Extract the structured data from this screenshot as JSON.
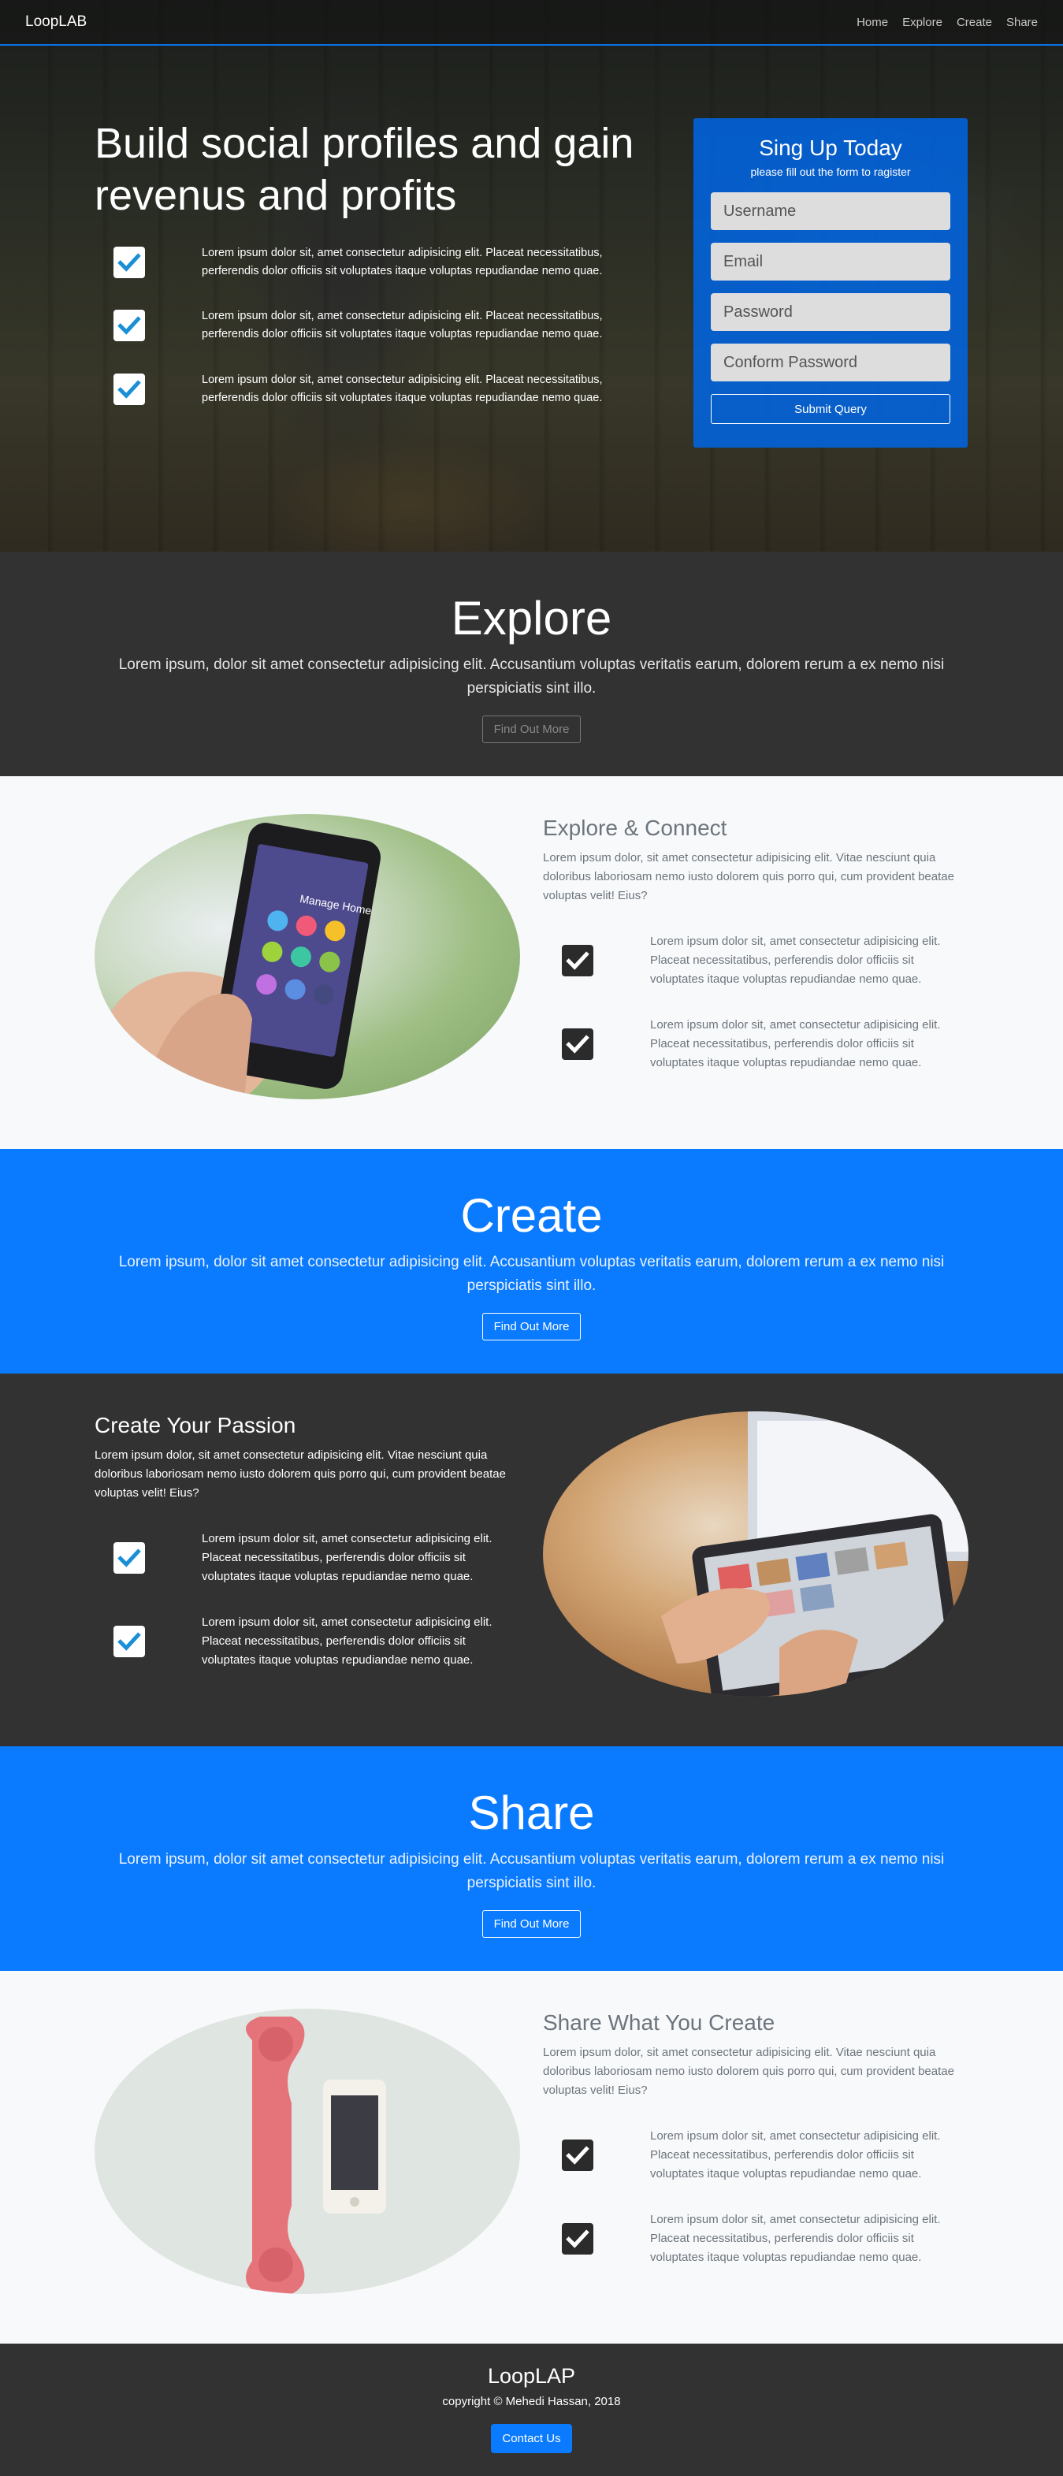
{
  "navbar": {
    "brand": "LoopLAB",
    "links": [
      "Home",
      "Explore",
      "Create",
      "Share"
    ]
  },
  "hero": {
    "title_part1": "Build ",
    "title_bold1": "social profiles",
    "title_part2": " and gain revenus and ",
    "title_bold2": "profits",
    "features": [
      "Lorem ipsum dolor sit, amet consectetur adipisicing elit. Placeat necessitatibus, perferendis dolor officiis sit voluptates itaque voluptas repudiandae nemo quae.",
      "Lorem ipsum dolor sit, amet consectetur adipisicing elit. Placeat necessitatibus, perferendis dolor officiis sit voluptates itaque voluptas repudiandae nemo quae.",
      "Lorem ipsum dolor sit, amet consectetur adipisicing elit. Placeat necessitatibus, perferendis dolor officiis sit voluptates itaque voluptas repudiandae nemo quae."
    ]
  },
  "signup": {
    "title": "Sing Up Today",
    "subtitle": "please fill out the form to ragister",
    "username_placeholder": "Username",
    "email_placeholder": "Email",
    "password_placeholder": "Password",
    "confirm_placeholder": "Conform Password",
    "submit_label": "Submit Query"
  },
  "explore_cta": {
    "heading": "Explore",
    "text": "Lorem ipsum, dolor sit amet consectetur adipisicing elit. Accusantium voluptas veritatis earum, dolorem rerum a ex nemo nisi perspiciatis sint illo.",
    "button": "Find Out More"
  },
  "explore_feature": {
    "heading": "Explore & Connect",
    "lead": "Lorem ipsum dolor, sit amet consectetur adipisicing elit. Vitae nesciunt quia doloribus laboriosam nemo iusto dolorem quis porro qui, cum provident beatae voluptas velit! Eius?",
    "items": [
      "Lorem ipsum dolor sit, amet consectetur adipisicing elit. Placeat necessitatibus, perferendis dolor officiis sit voluptates itaque voluptas repudiandae nemo quae.",
      "Lorem ipsum dolor sit, amet consectetur adipisicing elit. Placeat necessitatibus, perferendis dolor officiis sit voluptates itaque voluptas repudiandae nemo quae."
    ],
    "phone_screen_title": "Manage Home"
  },
  "create_cta": {
    "heading": "Create",
    "text": "Lorem ipsum, dolor sit amet consectetur adipisicing elit. Accusantium voluptas veritatis earum, dolorem rerum a ex nemo nisi perspiciatis sint illo.",
    "button": "Find Out More"
  },
  "create_feature": {
    "heading": "Create Your Passion",
    "lead": "Lorem ipsum dolor, sit amet consectetur adipisicing elit. Vitae nesciunt quia doloribus laboriosam nemo iusto dolorem quis porro qui, cum provident beatae voluptas velit! Eius?",
    "items": [
      "Lorem ipsum dolor sit, amet consectetur adipisicing elit. Placeat necessitatibus, perferendis dolor officiis sit voluptates itaque voluptas repudiandae nemo quae.",
      "Lorem ipsum dolor sit, amet consectetur adipisicing elit. Placeat necessitatibus, perferendis dolor officiis sit voluptates itaque voluptas repudiandae nemo quae."
    ]
  },
  "share_cta": {
    "heading": "Share",
    "text": "Lorem ipsum, dolor sit amet consectetur adipisicing elit. Accusantium voluptas veritatis earum, dolorem rerum a ex nemo nisi perspiciatis sint illo.",
    "button": "Find Out More"
  },
  "share_feature": {
    "heading": "Share What You Create",
    "lead": "Lorem ipsum dolor, sit amet consectetur adipisicing elit. Vitae nesciunt quia doloribus laboriosam nemo iusto dolorem quis porro qui, cum provident beatae voluptas velit! Eius?",
    "items": [
      "Lorem ipsum dolor sit, amet consectetur adipisicing elit. Placeat necessitatibus, perferendis dolor officiis sit voluptates itaque voluptas repudiandae nemo quae.",
      "Lorem ipsum dolor sit, amet consectetur adipisicing elit. Placeat necessitatibus, perferendis dolor officiis sit voluptates itaque voluptas repudiandae nemo quae."
    ]
  },
  "footer": {
    "brand": "LoopLAP",
    "copyright": "copyright © Mehedi Hassan, 2018",
    "button": "Contact Us"
  },
  "icons": {
    "check": "check-icon"
  },
  "colors": {
    "primary": "#0a7bff",
    "dark": "#323232",
    "check_blue": "#1a8fd6"
  }
}
